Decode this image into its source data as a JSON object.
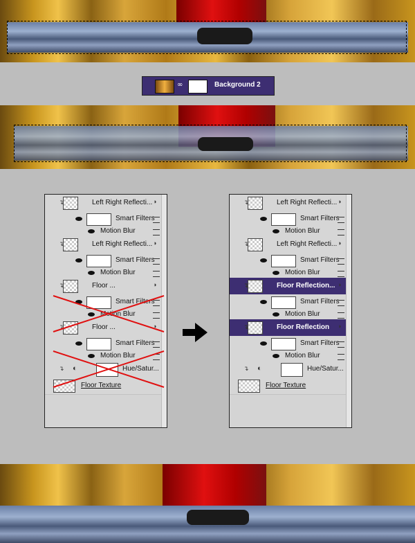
{
  "chip": {
    "label": "Background 2"
  },
  "left_panel": {
    "rows": [
      {
        "name": "Left Right Reflecti...",
        "kind": "layer"
      },
      {
        "name": "Smart Filters",
        "kind": "filter"
      },
      {
        "name": "Motion Blur",
        "kind": "effect"
      },
      {
        "name": "Left Right Reflecti...",
        "kind": "layer"
      },
      {
        "name": "Smart Filters",
        "kind": "filter"
      },
      {
        "name": "Motion Blur",
        "kind": "effect"
      },
      {
        "name": "Floor ...",
        "kind": "layer"
      },
      {
        "name": "Smart Filters",
        "kind": "filter"
      },
      {
        "name": "Motion Blur",
        "kind": "effect"
      },
      {
        "name": "Floor ...",
        "kind": "layer"
      },
      {
        "name": "Smart Filters",
        "kind": "filter"
      },
      {
        "name": "Motion Blur",
        "kind": "effect"
      },
      {
        "name": "Hue/Satur...",
        "kind": "adjust"
      },
      {
        "name": "Floor Texture",
        "kind": "base"
      }
    ]
  },
  "right_panel": {
    "rows": [
      {
        "name": "Left Right Reflecti...",
        "kind": "layer"
      },
      {
        "name": "Smart Filters",
        "kind": "filter"
      },
      {
        "name": "Motion Blur",
        "kind": "effect"
      },
      {
        "name": "Left Right Reflecti...",
        "kind": "layer"
      },
      {
        "name": "Smart Filters",
        "kind": "filter"
      },
      {
        "name": "Motion Blur",
        "kind": "effect"
      },
      {
        "name": "Floor Reflection...",
        "kind": "layer",
        "selected": true
      },
      {
        "name": "Smart Filters",
        "kind": "filter"
      },
      {
        "name": "Motion Blur",
        "kind": "effect"
      },
      {
        "name": "Floor Reflection",
        "kind": "layer",
        "selected": true
      },
      {
        "name": "Smart Filters",
        "kind": "filter"
      },
      {
        "name": "Motion Blur",
        "kind": "effect"
      },
      {
        "name": "Hue/Satur...",
        "kind": "adjust"
      },
      {
        "name": "Floor Texture",
        "kind": "base"
      }
    ]
  },
  "colors": {
    "highlight": "#3d2e72",
    "cross": "#e01010"
  }
}
